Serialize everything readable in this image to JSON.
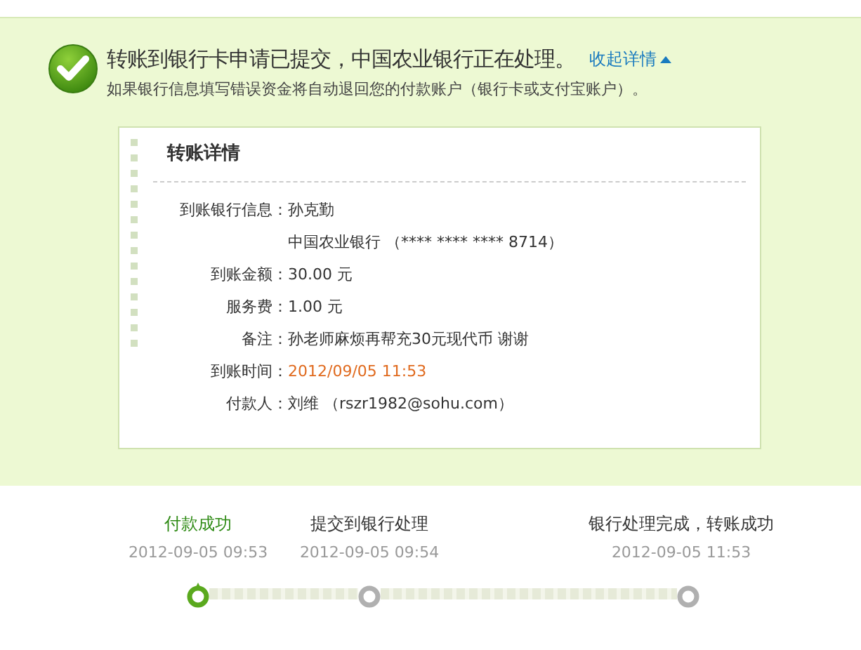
{
  "notice": {
    "title": "转账到银行卡申请已提交，中国农业银行正在处理。",
    "toggle": "收起详情",
    "expanded": true,
    "subtitle": "如果银行信息填写错误资金将自动退回您的付款账户（银行卡或支付宝账户）。"
  },
  "details": {
    "title": "转账详情",
    "rows": [
      {
        "label": "到账银行信息：",
        "value": "孙克勤",
        "highlight": false
      },
      {
        "value": "中国农业银行 （**** **** **** 8714）",
        "highlight": false
      },
      {
        "label": "到账金额：",
        "value": "30.00 元",
        "highlight": false
      },
      {
        "label": "服务费：",
        "value": "1.00 元",
        "highlight": false
      },
      {
        "label": "备注：",
        "value": "孙老师麻烦再帮充30元现代币 谢谢",
        "highlight": false
      },
      {
        "label": "到账时间：",
        "value": "2012/09/05 11:53",
        "highlight": true
      },
      {
        "label": "付款人：",
        "value": "刘维 （rszr1982@sohu.com）",
        "highlight": false
      }
    ]
  },
  "steps": [
    {
      "label": "付款成功",
      "time": "2012-09-05 09:53",
      "done": true
    },
    {
      "label": "提交到银行处理",
      "time": "2012-09-05 09:54",
      "done": false
    },
    {
      "label": "银行处理完成，转账成功",
      "time": "2012-09-05 11:53",
      "done": false
    }
  ]
}
